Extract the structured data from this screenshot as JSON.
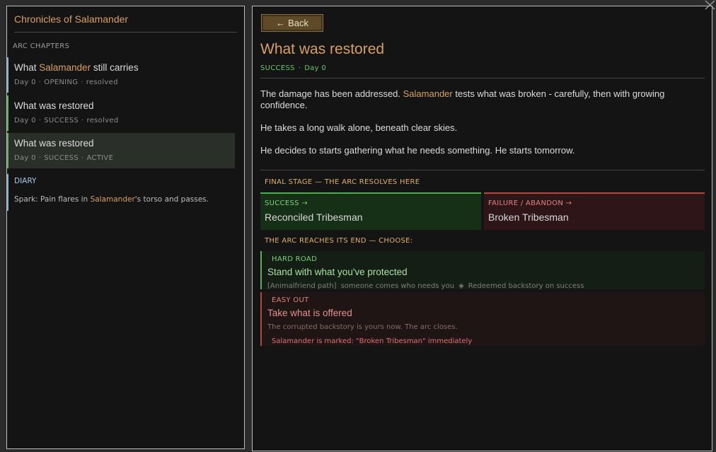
{
  "sidebar": {
    "title": "Chronicles of Salamander",
    "arc_label": "ARC CHAPTERS",
    "chapters": [
      {
        "title_pre": "What ",
        "title_hl": "Salamander",
        "title_post": " still carries",
        "day": "Day 0",
        "stage": "OPENING",
        "state": "resolved",
        "border_color": "#8aaed0"
      },
      {
        "title_pre": "What was restored",
        "title_hl": "",
        "title_post": "",
        "day": "Day 0",
        "stage": "SUCCESS",
        "state": "resolved",
        "border_color": "#5fae5f"
      },
      {
        "title_pre": "What was restored",
        "title_hl": "",
        "title_post": "",
        "day": "Day 0",
        "stage": "SUCCESS",
        "state": "ACTIVE",
        "border_color": "#5fae5f"
      }
    ],
    "diary": {
      "label": "DIARY",
      "text_pre": "Spark: Pain flares in ",
      "text_hl": "Salamander",
      "text_post": "'s torso and passes."
    }
  },
  "main": {
    "back": {
      "arrow": "←",
      "label": "Back"
    },
    "title": "What was restored",
    "status": {
      "stage": "SUCCESS",
      "day": "Day 0"
    },
    "para1_pre": "The damage has been addressed. ",
    "para1_hl": "Salamander",
    "para1_post": " tests what was broken - carefully, then with growing confidence.",
    "para2": "He takes a long walk alone, beneath clear skies.",
    "para3": "He decides to starts gathering what he needs something. He starts tomorrow.",
    "final_stage_label": "FINAL STAGE — THE ARC RESOLVES HERE",
    "outcomes": {
      "success": {
        "label": "SUCCESS →",
        "value": "Reconciled Tribesman"
      },
      "failure": {
        "label": "FAILURE / ABANDON →",
        "value": "Broken Tribesman"
      }
    },
    "choose_label": "THE ARC REACHES ITS END — CHOOSE:",
    "choices": {
      "hard": {
        "tag": "HARD ROAD",
        "title": "Stand with what you've protected",
        "path": "[Animalfriend path]",
        "desc1": "someone comes who needs you",
        "diamond": "◈",
        "desc2": "Redeemed backstory on success"
      },
      "easy": {
        "tag": "EASY OUT",
        "title": "Take what is offered",
        "desc": "The corrupted backstory is yours now. The arc closes.",
        "warn": "Salamander is marked: \"Broken Tribesman\" immediately"
      }
    }
  },
  "colors": {
    "accent": "#d8a060",
    "success": "#5fae5f",
    "failure": "#b04848",
    "info": "#8aaed0"
  },
  "icons": {
    "close": "close-icon"
  }
}
